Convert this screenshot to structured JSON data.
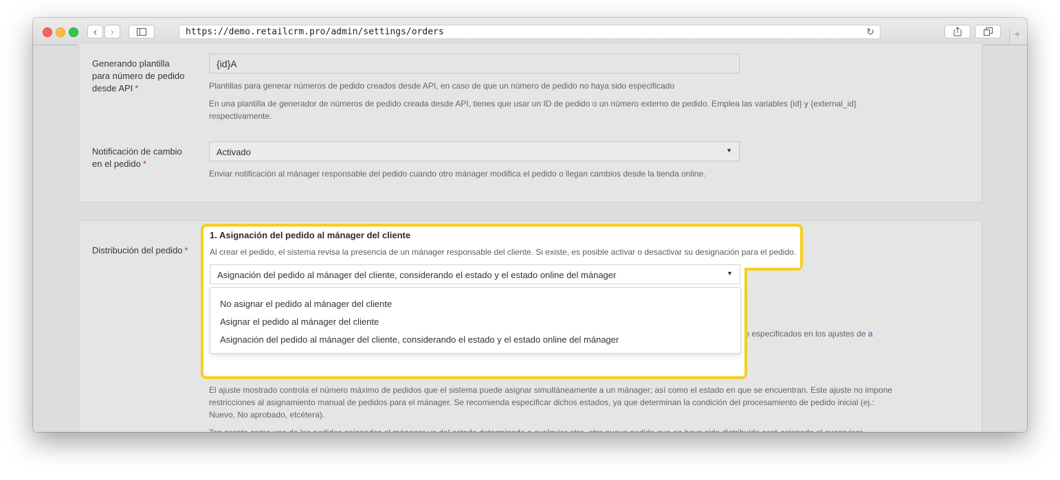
{
  "browser": {
    "url": "https://demo.retailcrm.pro/admin/settings/orders"
  },
  "section1": {
    "api_template_label_lines": [
      "Generando plantilla",
      "para número de pedido",
      "desde API"
    ],
    "api_template_value": "{id}A",
    "api_template_help1": "Plantillas para generar números de pedido creados desde API, en caso de que un número de pedido no haya sido especificado",
    "api_template_help2_line1": "En una plantilla de generador de números de pedido creada desde API, tienes que usar un ID de pedido o un número externo de pedido. Emplea las variables {id} y {external_id}",
    "api_template_help2_line2": "respectivamente.",
    "notif_label_lines": [
      "Notificación de cambio",
      "en el pedido"
    ],
    "notif_value": "Activado",
    "notif_help": "Enviar notificación al mánager responsable del pedido cuando otro mánager modifica el pedido o llegan cambios desde la tienda online.",
    "required_mark": "*"
  },
  "section2": {
    "distribution_label": "Distribución del pedido",
    "required_mark": "*",
    "assignment_title": "1. Asignación del pedido al mánager del cliente",
    "assignment_desc": "Al crear el pedido, el sistema revisa la presencia de un mánager responsable del cliente. Si existe, es posible activar o desactivar su designación para el pedido.",
    "assignment_selected": "Asignación del pedido al mánager del cliente, considerando el estado y el estado online del mánager",
    "options": [
      "No asignar el pedido al mánager del cliente",
      "Asignar el pedido al mánager del cliente",
      "Asignación del pedido al mánager del cliente, considerando el estado y el estado online del mánager"
    ],
    "partial_right_text": "n sido especificados en los ajustes de",
    "partial_link": "a",
    "limit_help_line1": "El ajuste mostrado controla el número máximo de pedidos que el sistema puede asignar simultáneamente a un mánager; así como el estado en que se encuentran. Este ajuste no impone",
    "limit_help_line2": "restricciones al asignamiento manual de pedidos para el mánager. Se recomienda especificar dichos estados, ya que determinan la condición del procesamiento de pedido inicial (ej.:",
    "limit_help_line3": "Nuevo, No aprobado, etcétera).",
    "supervisor_help": "Tan pronto como uno de los pedidos asignados al mánager va del estado determinado a cualquier otro, otro nuevo pedido que no haya sido distribuido será asignado al sueprvisor."
  }
}
